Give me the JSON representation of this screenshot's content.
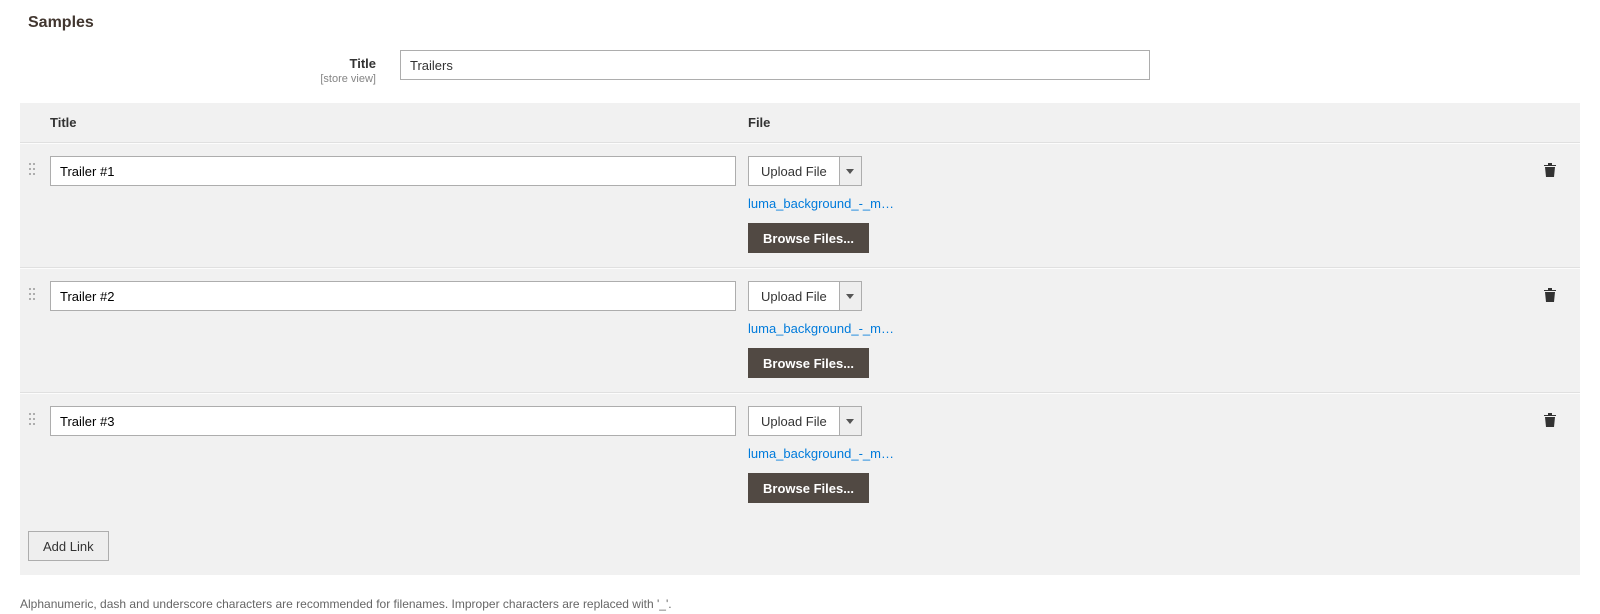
{
  "section": {
    "heading": "Samples",
    "title_label": "Title",
    "title_scope": "[store view]",
    "title_value": "Trailers"
  },
  "columns": {
    "title": "Title",
    "file": "File"
  },
  "upload_label": "Upload File",
  "browse_label": "Browse Files...",
  "rows": [
    {
      "title": "Trailer #1",
      "file_link": "luma_background_-_mo..."
    },
    {
      "title": "Trailer #2",
      "file_link": "luma_background_-_mo..."
    },
    {
      "title": "Trailer #3",
      "file_link": "luma_background_-_mo..."
    }
  ],
  "add_link_label": "Add Link",
  "hint": "Alphanumeric, dash and underscore characters are recommended for filenames. Improper characters are replaced with '_'."
}
